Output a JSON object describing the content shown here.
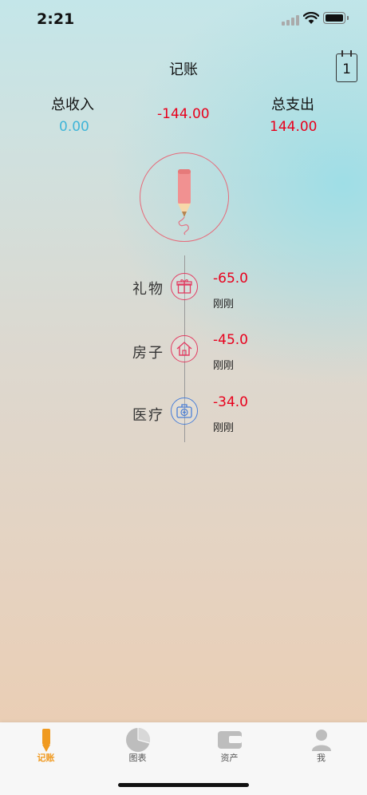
{
  "status": {
    "time": "2:21"
  },
  "header": {
    "title": "记账",
    "calendar_day": "1"
  },
  "summary": {
    "income_label": "总收入",
    "income_value": "0.00",
    "balance_value": "-144.00",
    "expense_label": "总支出",
    "expense_value": "144.00"
  },
  "entries": [
    {
      "category": "礼物",
      "amount": "-65.0",
      "time": "刚刚",
      "icon": "gift-icon"
    },
    {
      "category": "房子",
      "amount": "-45.0",
      "time": "刚刚",
      "icon": "house-icon"
    },
    {
      "category": "医疗",
      "amount": "-34.0",
      "time": "刚刚",
      "icon": "medical-kit-icon"
    }
  ],
  "tabs": [
    {
      "label": "记账",
      "icon": "pencil-icon",
      "active": true
    },
    {
      "label": "图表",
      "icon": "pie-chart-icon",
      "active": false
    },
    {
      "label": "资产",
      "icon": "wallet-icon",
      "active": false
    },
    {
      "label": "我",
      "icon": "person-icon",
      "active": false
    }
  ],
  "colors": {
    "income": "#3fb5d8",
    "expense": "#e8001c",
    "accent": "#f09a20",
    "tab_inactive": "#bdbdbd"
  }
}
